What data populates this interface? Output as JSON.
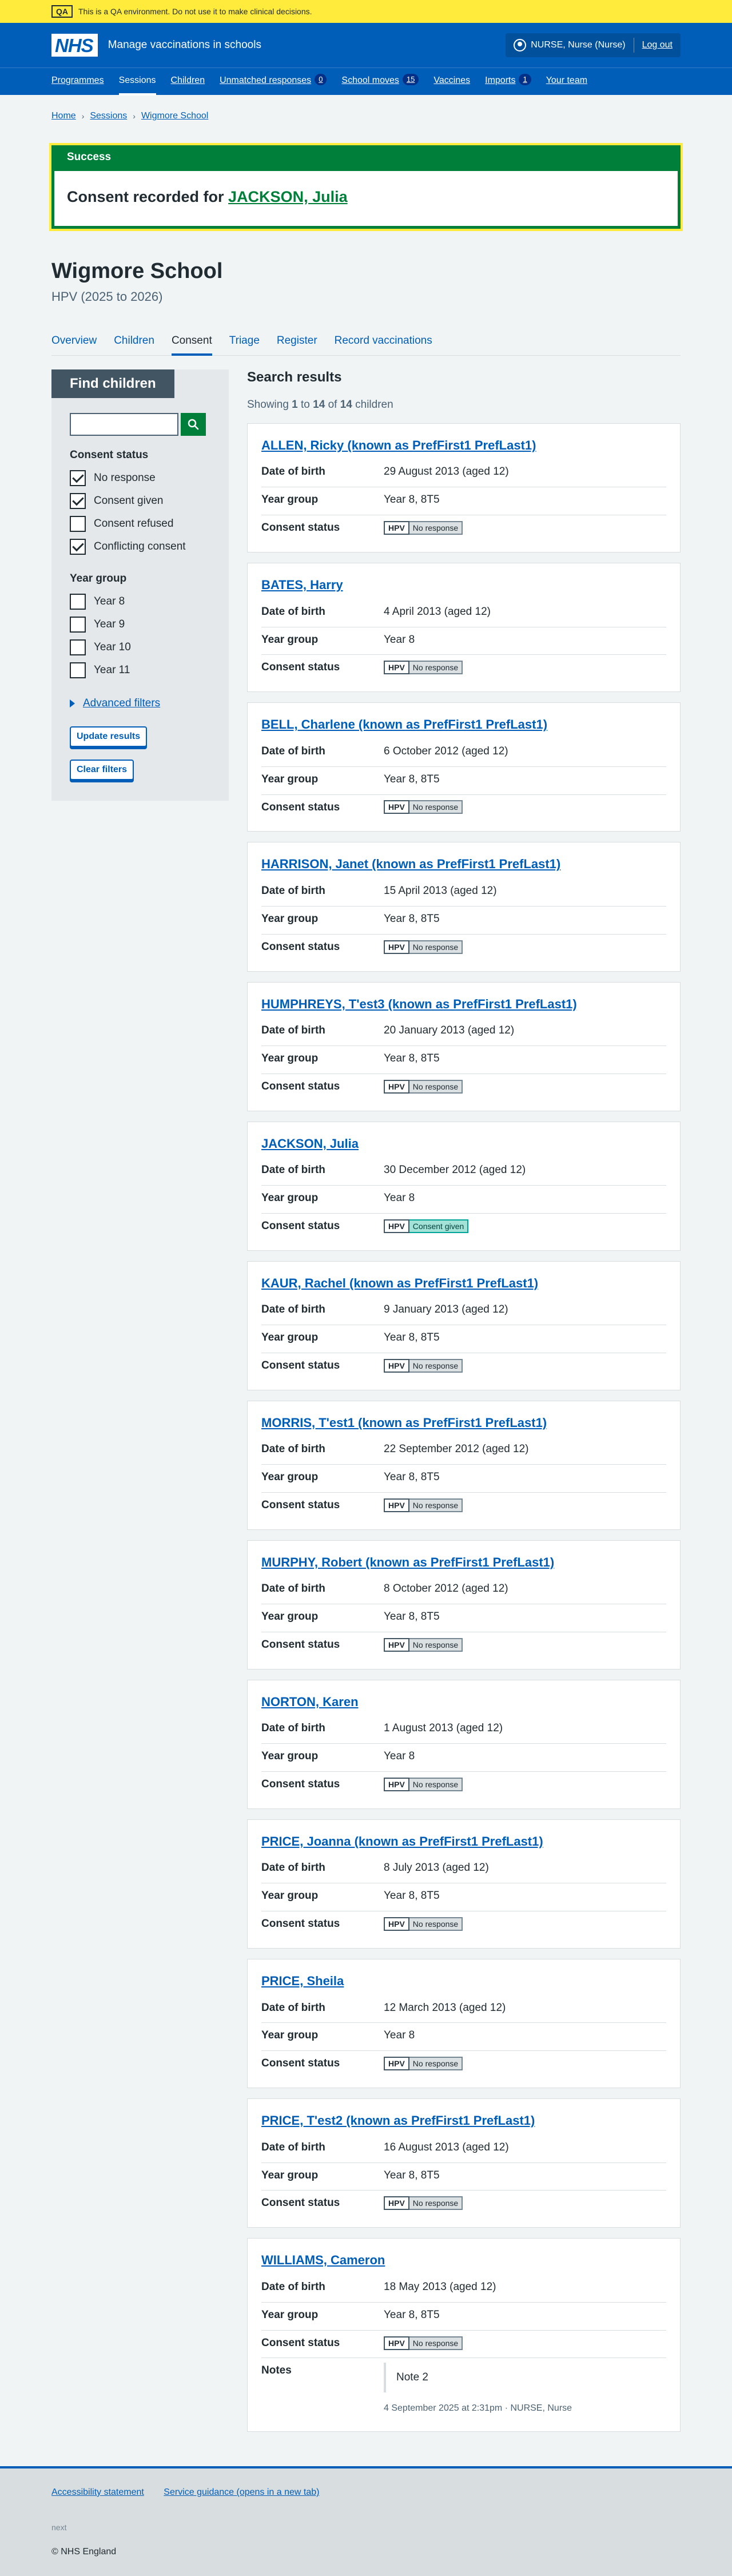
{
  "qa_banner": {
    "tag": "QA",
    "text": "This is a QA environment. Do not use it to make clinical decisions."
  },
  "header": {
    "logo": "NHS",
    "service_name": "Manage vaccinations in schools",
    "account_name": "NURSE, Nurse (Nurse)",
    "logout": "Log out",
    "nav": [
      {
        "label": "Programmes"
      },
      {
        "label": "Sessions",
        "current": true
      },
      {
        "label": "Children"
      },
      {
        "label": "Unmatched responses",
        "count": "0"
      },
      {
        "label": "School moves",
        "count": "15"
      },
      {
        "label": "Vaccines"
      },
      {
        "label": "Imports",
        "count": "1"
      },
      {
        "label": "Your team"
      }
    ]
  },
  "breadcrumb": [
    "Home",
    "Sessions",
    "Wigmore School"
  ],
  "notification": {
    "heading": "Success",
    "message_prefix": "Consent recorded for ",
    "message_link": "JACKSON, Julia"
  },
  "page": {
    "title": "Wigmore School",
    "caption": "HPV (2025 to 2026)"
  },
  "sub_nav": [
    "Overview",
    "Children",
    "Consent",
    "Triage",
    "Register",
    "Record vaccinations"
  ],
  "sub_nav_current": "Consent",
  "filters": {
    "title": "Find children",
    "search_value": "",
    "consent_legend": "Consent status",
    "consent_options": [
      {
        "label": "No response",
        "checked": true
      },
      {
        "label": "Consent given",
        "checked": true
      },
      {
        "label": "Consent refused",
        "checked": false
      },
      {
        "label": "Conflicting consent",
        "checked": true
      }
    ],
    "year_legend": "Year group",
    "year_options": [
      {
        "label": "Year 8",
        "checked": false
      },
      {
        "label": "Year 9",
        "checked": false
      },
      {
        "label": "Year 10",
        "checked": false
      },
      {
        "label": "Year 11",
        "checked": false
      }
    ],
    "advanced": "Advanced filters",
    "update_button": "Update results",
    "clear_button": "Clear filters"
  },
  "results": {
    "title": "Search results",
    "count_prefix": "Showing ",
    "from": "1",
    "to_word": " to ",
    "to": "14",
    "of_word": " of ",
    "total": "14",
    "suffix": " children",
    "labels": {
      "dob": "Date of birth",
      "year": "Year group",
      "consent": "Consent status",
      "notes": "Notes"
    },
    "children": [
      {
        "name": "ALLEN, Ricky (known as PrefFirst1 PrefLast1)",
        "dob": "29 August 2013 (aged 12)",
        "year": "Year 8, 8T5",
        "programme": "HPV",
        "status": "No response"
      },
      {
        "name": "BATES, Harry",
        "dob": "4 April 2013 (aged 12)",
        "year": "Year 8",
        "programme": "HPV",
        "status": "No response"
      },
      {
        "name": "BELL, Charlene (known as PrefFirst1 PrefLast1)",
        "dob": "6 October 2012 (aged 12)",
        "year": "Year 8, 8T5",
        "programme": "HPV",
        "status": "No response"
      },
      {
        "name": "HARRISON, Janet (known as PrefFirst1 PrefLast1)",
        "dob": "15 April 2013 (aged 12)",
        "year": "Year 8, 8T5",
        "programme": "HPV",
        "status": "No response"
      },
      {
        "name": "HUMPHREYS, T'est3 (known as PrefFirst1 PrefLast1)",
        "dob": "20 January 2013 (aged 12)",
        "year": "Year 8, 8T5",
        "programme": "HPV",
        "status": "No response"
      },
      {
        "name": "JACKSON, Julia",
        "dob": "30 December 2012 (aged 12)",
        "year": "Year 8",
        "programme": "HPV",
        "status": "Consent given",
        "given": true
      },
      {
        "name": "KAUR, Rachel (known as PrefFirst1 PrefLast1)",
        "dob": "9 January 2013 (aged 12)",
        "year": "Year 8, 8T5",
        "programme": "HPV",
        "status": "No response"
      },
      {
        "name": "MORRIS, T'est1 (known as PrefFirst1 PrefLast1)",
        "dob": "22 September 2012 (aged 12)",
        "year": "Year 8, 8T5",
        "programme": "HPV",
        "status": "No response"
      },
      {
        "name": "MURPHY, Robert (known as PrefFirst1 PrefLast1)",
        "dob": "8 October 2012 (aged 12)",
        "year": "Year 8, 8T5",
        "programme": "HPV",
        "status": "No response"
      },
      {
        "name": "NORTON, Karen",
        "dob": "1 August 2013 (aged 12)",
        "year": "Year 8",
        "programme": "HPV",
        "status": "No response"
      },
      {
        "name": "PRICE, Joanna (known as PrefFirst1 PrefLast1)",
        "dob": "8 July 2013 (aged 12)",
        "year": "Year 8, 8T5",
        "programme": "HPV",
        "status": "No response"
      },
      {
        "name": "PRICE, Sheila",
        "dob": "12 March 2013 (aged 12)",
        "year": "Year 8",
        "programme": "HPV",
        "status": "No response"
      },
      {
        "name": "PRICE, T'est2 (known as PrefFirst1 PrefLast1)",
        "dob": "16 August 2013 (aged 12)",
        "year": "Year 8, 8T5",
        "programme": "HPV",
        "status": "No response"
      },
      {
        "name": "WILLIAMS, Cameron",
        "dob": "18 May 2013 (aged 12)",
        "year": "Year 8, 8T5",
        "programme": "HPV",
        "status": "No response",
        "note": "Note 2",
        "note_meta": "4 September 2025 at 2:31pm · NURSE, Nurse"
      }
    ]
  },
  "footer": {
    "links": [
      "Accessibility statement",
      "Service guidance (opens in a new tab)"
    ],
    "version": "next",
    "copyright": "© NHS England"
  },
  "colors": {
    "nhs_blue": "#005eb8",
    "success_green": "#007f3b",
    "qa_yellow": "#ffeb3b",
    "consent_given_bg": "#a3e2d7"
  }
}
